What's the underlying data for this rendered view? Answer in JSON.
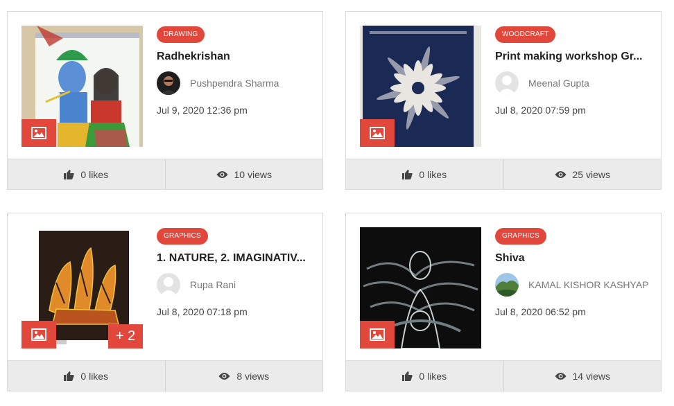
{
  "cards": [
    {
      "category": "DRAWING",
      "title": "Radhekrishan",
      "author": "Pushpendra Sharma",
      "date": "Jul 9, 2020 12:36 pm",
      "likes": "0 likes",
      "views": "10 views",
      "image_icon": "image-icon"
    },
    {
      "category": "WOODCRAFT",
      "title": "Print making workshop Gr...",
      "author": "Meenal Gupta",
      "date": "Jul 8, 2020 07:59 pm",
      "likes": "0 likes",
      "views": "25 views",
      "image_icon": "image-icon"
    },
    {
      "category": "GRAPHICS",
      "title": "1. NATURE, 2. IMAGINATIV...",
      "author": "Rupa Rani",
      "date": "Jul 8, 2020 07:18 pm",
      "likes": "0 likes",
      "views": "8 views",
      "more_images": "+ 2",
      "image_icon": "image-icon"
    },
    {
      "category": "GRAPHICS",
      "title": "Shiva",
      "author": "KAMAL KISHOR KASHYAP",
      "date": "Jul 8, 2020 06:52 pm",
      "likes": "0 likes",
      "views": "14 views",
      "image_icon": "image-icon"
    }
  ],
  "colors": {
    "accent": "#e2473b",
    "footer_bg": "#ebebeb",
    "border": "#d9d9d9"
  },
  "icons": {
    "likes": "thumbs-up-icon",
    "views": "eye-icon"
  }
}
